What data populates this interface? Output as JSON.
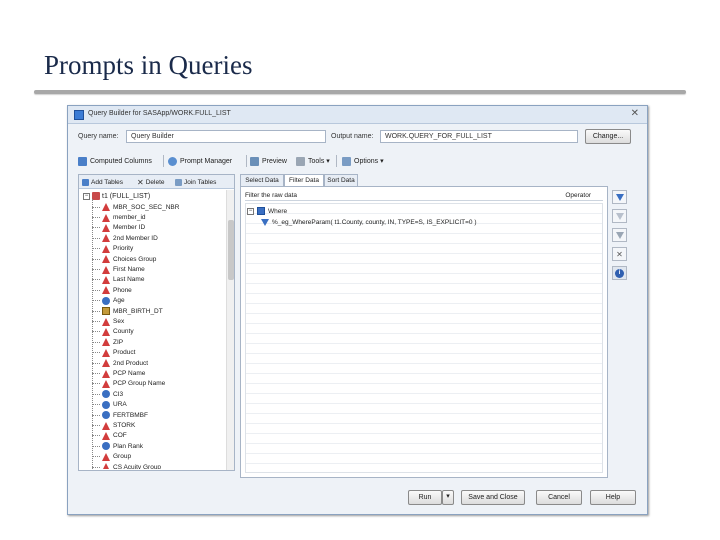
{
  "slide": {
    "title": "Prompts in Queries"
  },
  "window": {
    "title": "Query Builder for SASApp/WORK.FULL_LIST",
    "close_glyph": "✕"
  },
  "fields": {
    "query_name_label": "Query name:",
    "query_name_value": "Query Builder",
    "output_name_label": "Output name:",
    "output_name_value": "WORK.QUERY_FOR_FULL_LIST",
    "change_button": "Change..."
  },
  "toolbar": {
    "computed_columns": "Computed Columns",
    "prompt_manager": "Prompt Manager",
    "preview": "Preview",
    "tools": "Tools ▾",
    "options": "Options ▾"
  },
  "left_panel": {
    "tabs": {
      "add_tables": "Add Tables",
      "delete": "Delete",
      "join_tables": "Join Tables"
    },
    "root": "t1 (FULL_LIST)",
    "items": [
      {
        "label": "MBR_SOC_SEC_NBR",
        "type": "char"
      },
      {
        "label": "member_id",
        "type": "char"
      },
      {
        "label": "Member ID",
        "type": "char"
      },
      {
        "label": "2nd Member ID",
        "type": "char"
      },
      {
        "label": "Priority",
        "type": "char"
      },
      {
        "label": "Choices Group",
        "type": "char"
      },
      {
        "label": "First Name",
        "type": "char"
      },
      {
        "label": "Last Name",
        "type": "char"
      },
      {
        "label": "Phone",
        "type": "char"
      },
      {
        "label": "Age",
        "type": "num"
      },
      {
        "label": "MBR_BIRTH_DT",
        "type": "date"
      },
      {
        "label": "Sex",
        "type": "char"
      },
      {
        "label": "County",
        "type": "char"
      },
      {
        "label": "ZIP",
        "type": "char"
      },
      {
        "label": "Product",
        "type": "char"
      },
      {
        "label": "2nd Product",
        "type": "char"
      },
      {
        "label": "PCP Name",
        "type": "char"
      },
      {
        "label": "PCP Group Name",
        "type": "char"
      },
      {
        "label": "CI3",
        "type": "num"
      },
      {
        "label": "URA",
        "type": "num"
      },
      {
        "label": "FERTBMBF",
        "type": "num"
      },
      {
        "label": "STORK",
        "type": "char"
      },
      {
        "label": "COF",
        "type": "char"
      },
      {
        "label": "Plan Rank",
        "type": "num"
      },
      {
        "label": "Group",
        "type": "char"
      },
      {
        "label": "CS Acuity Group",
        "type": "char"
      }
    ]
  },
  "right_panel": {
    "tabs": {
      "select_data": "Select Data",
      "filter_data": "Filter Data",
      "sort_data": "Sort Data"
    },
    "grid_header": "Filter the raw data",
    "operator_header": "Operator",
    "where_label": "Where",
    "filter_expression": "%_eg_WhereParam( t1.County, county, IN, TYPE=S, IS_EXPLICIT=0 )"
  },
  "side_tools": [
    "filter-edit-icon",
    "filter-disabled-icon",
    "filter-group-icon",
    "delete-icon",
    "info-icon"
  ],
  "buttons": {
    "run": "Run",
    "save_and_close": "Save and Close",
    "cancel": "Cancel",
    "help": "Help"
  },
  "colors": {
    "accent": "#3a6fc2",
    "char_icon": "#d23c3c",
    "window_bg": "#eef2f7",
    "title_text": "#1a2a4a"
  }
}
